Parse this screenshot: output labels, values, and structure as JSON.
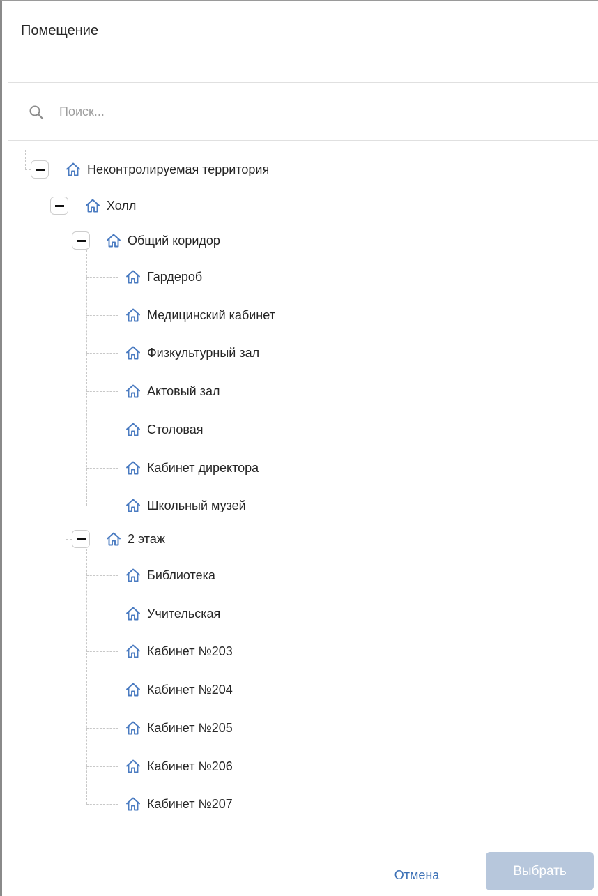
{
  "dialog": {
    "title": "Помещение"
  },
  "search": {
    "placeholder": "Поиск...",
    "value": ""
  },
  "colors": {
    "icon": "#4a7bc1",
    "primary_disabled": "#b7c7dc",
    "link": "#3a6fb5"
  },
  "tree": {
    "root": {
      "label": "Неконтролируемая территория",
      "icon": "home-icon",
      "expanded": true,
      "children": [
        {
          "label": "Холл",
          "icon": "home-icon",
          "expanded": true,
          "children": [
            {
              "label": "Общий коридор",
              "icon": "home-icon",
              "expanded": true,
              "children": [
                {
                  "label": "Гардероб"
                },
                {
                  "label": "Медицинский кабинет"
                },
                {
                  "label": "Физкультурный зал"
                },
                {
                  "label": "Актовый зал"
                },
                {
                  "label": "Столовая"
                },
                {
                  "label": "Кабинет директора"
                },
                {
                  "label": "Школьный музей"
                }
              ]
            },
            {
              "label": "2 этаж",
              "icon": "home-icon",
              "expanded": true,
              "children": [
                {
                  "label": "Библиотека"
                },
                {
                  "label": "Учительская"
                },
                {
                  "label": "Кабинет №203"
                },
                {
                  "label": "Кабинет №204"
                },
                {
                  "label": "Кабинет №205"
                },
                {
                  "label": "Кабинет №206"
                },
                {
                  "label": "Кабинет №207"
                }
              ]
            }
          ]
        }
      ]
    }
  },
  "footer": {
    "cancel_label": "Отмена",
    "select_label": "Выбрать"
  }
}
